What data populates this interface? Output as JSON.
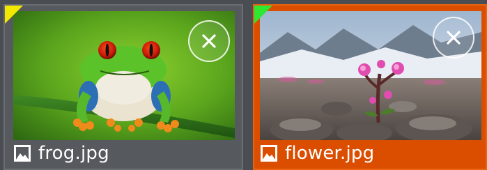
{
  "items": [
    {
      "filename": "frog.jpg",
      "selected": false,
      "corner_color": "#f3e800",
      "remove_icon": "close-icon",
      "file_icon": "image-icon"
    },
    {
      "filename": "flower.jpg",
      "selected": true,
      "corner_color": "#2ee72e",
      "remove_icon": "close-icon",
      "file_icon": "image-icon"
    }
  ],
  "colors": {
    "panel_bg": "#4a4d52",
    "card_bg": "#56595e",
    "selected_bg": "#db4e00",
    "text": "#ffffff"
  }
}
